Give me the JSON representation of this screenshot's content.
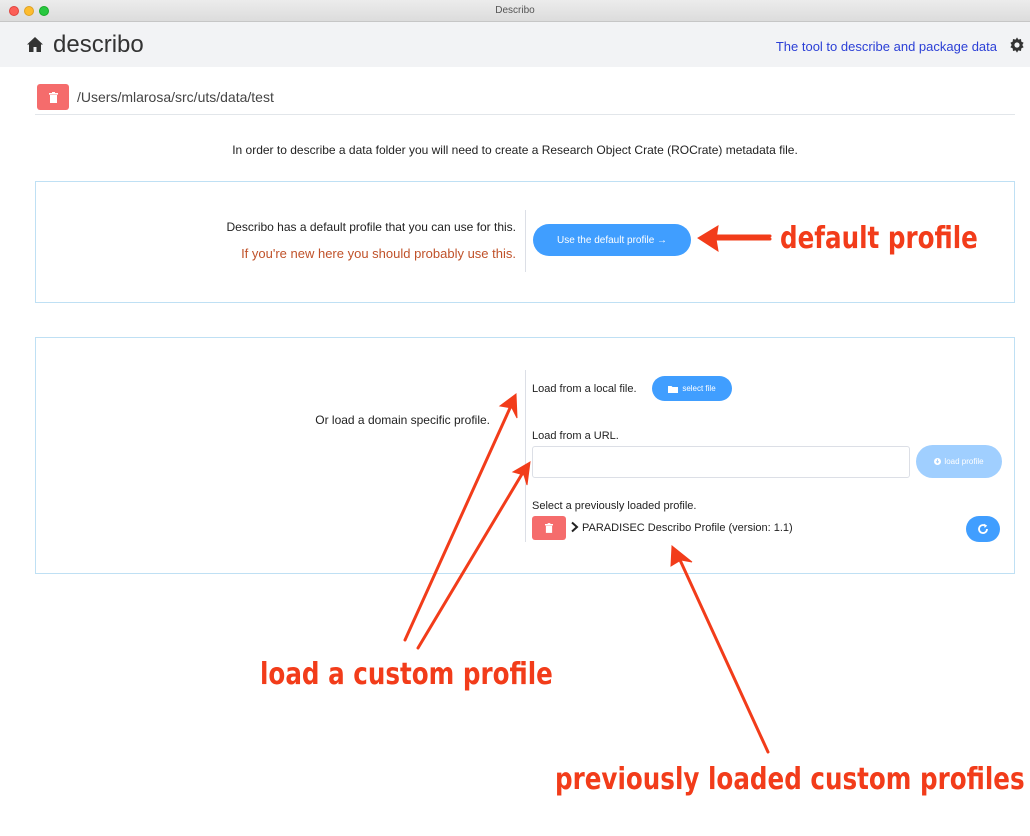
{
  "window": {
    "title": "Describo"
  },
  "header": {
    "brand": "describo",
    "tagline": "The tool to describe and package data",
    "icons": {
      "home": "home-icon",
      "settings": "gear-icon"
    }
  },
  "path": {
    "value": "/Users/mlarosa/src/uts/data/test",
    "delete_icon": "trash-icon"
  },
  "intro": "In order to describe a data folder you will need to create a Research Object Crate (ROCrate) metadata file.",
  "default_profile": {
    "description": "Describo has a default profile that you can use for this.",
    "hint": "If you're new here you should probably use this.",
    "button_label": "Use the default profile →"
  },
  "domain_profile": {
    "description": "Or load a domain specific profile.",
    "local_file_label": "Load from a local file.",
    "select_file_button": "select file",
    "url_label": "Load from a URL.",
    "url_value": "",
    "load_profile_button": "load profile",
    "previous_label": "Select a previously loaded profile.",
    "previous_profiles": [
      {
        "name": "PARADISEC Describo Profile (version: 1.1)"
      }
    ]
  },
  "annotations": {
    "default_profile": "default profile",
    "custom_profile": "load a custom profile",
    "previous_profiles": "previously loaded custom profiles"
  },
  "colors": {
    "primary": "#409eff",
    "danger": "#f56c6c",
    "annotation": "#f23c1a",
    "hint": "#c0522a",
    "tagline": "#2b3fd6"
  }
}
